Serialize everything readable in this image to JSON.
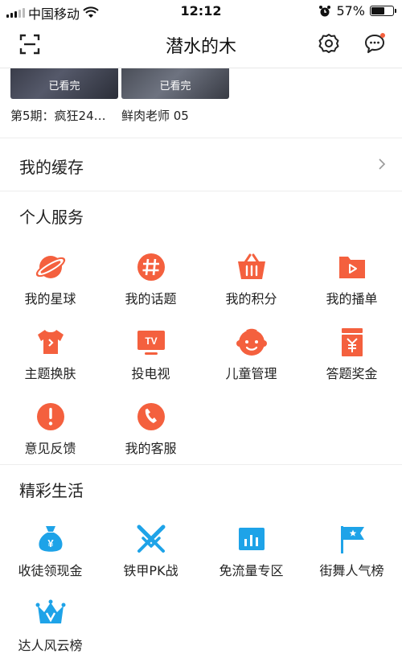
{
  "status": {
    "carrier": "中国移动",
    "time": "12:12",
    "battery": "57%",
    "battery_level": 0.57
  },
  "nav": {
    "title": "潜水的木"
  },
  "history": {
    "items": [
      {
        "title": "第5期：疯狂24…",
        "badge": "已看完"
      },
      {
        "title": "鲜肉老师 05",
        "badge": "已看完"
      }
    ]
  },
  "cache": {
    "label": "我的缓存"
  },
  "personal": {
    "title": "个人服务",
    "items": [
      {
        "label": "我的星球",
        "icon": "planet-icon"
      },
      {
        "label": "我的话题",
        "icon": "topic-hash-icon"
      },
      {
        "label": "我的积分",
        "icon": "points-basket-icon"
      },
      {
        "label": "我的播单",
        "icon": "playlist-icon"
      },
      {
        "label": "主题换肤",
        "icon": "theme-shirt-icon"
      },
      {
        "label": "投电视",
        "icon": "tv-cast-icon"
      },
      {
        "label": "儿童管理",
        "icon": "kid-face-icon"
      },
      {
        "label": "答题奖金",
        "icon": "quiz-bonus-icon"
      },
      {
        "label": "意见反馈",
        "icon": "feedback-icon"
      },
      {
        "label": "我的客服",
        "icon": "customer-service-icon"
      }
    ]
  },
  "life": {
    "title": "精彩生活",
    "items": [
      {
        "label": "收徒领现金",
        "icon": "money-bag-icon"
      },
      {
        "label": "铁甲PK战",
        "icon": "crossed-swords-icon"
      },
      {
        "label": "免流量专区",
        "icon": "data-free-icon"
      },
      {
        "label": "街舞人气榜",
        "icon": "flag-icon"
      },
      {
        "label": "达人风云榜",
        "icon": "crown-icon"
      }
    ]
  },
  "colors": {
    "accent_orange": "#F4603E",
    "accent_blue": "#1EA3E8"
  }
}
